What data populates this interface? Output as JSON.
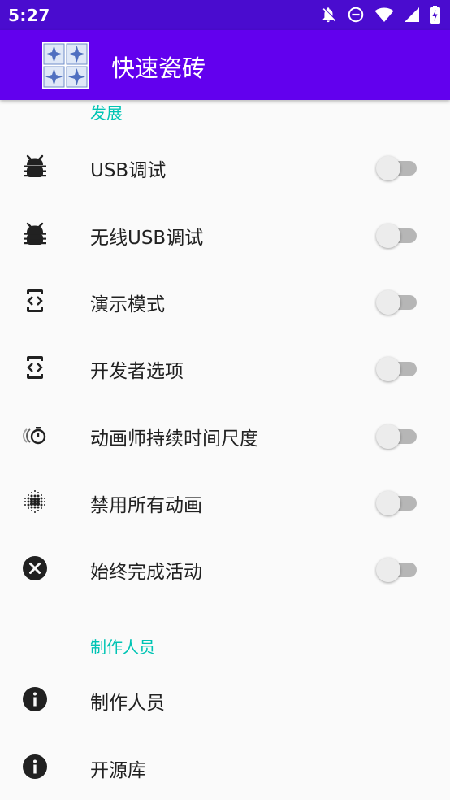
{
  "status_bar": {
    "time": "5:27",
    "icons": [
      "notifications-off-icon",
      "do-not-disturb-icon",
      "wifi-icon",
      "signal-icon",
      "battery-charging-icon"
    ]
  },
  "app_bar": {
    "title": "快速瓷砖",
    "logo_icon": "tile-pattern-icon",
    "color": "#6200ee",
    "status_color": "#4a0ccf"
  },
  "sections": {
    "development": {
      "title": "发展",
      "items": [
        {
          "label": "USB调试",
          "icon": "bug-icon",
          "enabled": false
        },
        {
          "label": "无线USB调试",
          "icon": "bug-icon",
          "enabled": false
        },
        {
          "label": "演示模式",
          "icon": "developer-mode-icon",
          "enabled": false
        },
        {
          "label": "开发者选项",
          "icon": "developer-mode-icon",
          "enabled": false
        },
        {
          "label": "动画师持续时间尺度",
          "icon": "animation-timer-icon",
          "enabled": false
        },
        {
          "label": "禁用所有动画",
          "icon": "blur-dots-icon",
          "enabled": false
        },
        {
          "label": "始终完成活动",
          "icon": "cancel-circle-icon",
          "enabled": false
        }
      ]
    },
    "credits": {
      "title": "制作人员",
      "items": [
        {
          "label": "制作人员",
          "icon": "info-icon"
        },
        {
          "label": "开源库",
          "icon": "info-icon"
        }
      ]
    }
  },
  "colors": {
    "accent": "#00c4b4",
    "text": "#212121"
  }
}
